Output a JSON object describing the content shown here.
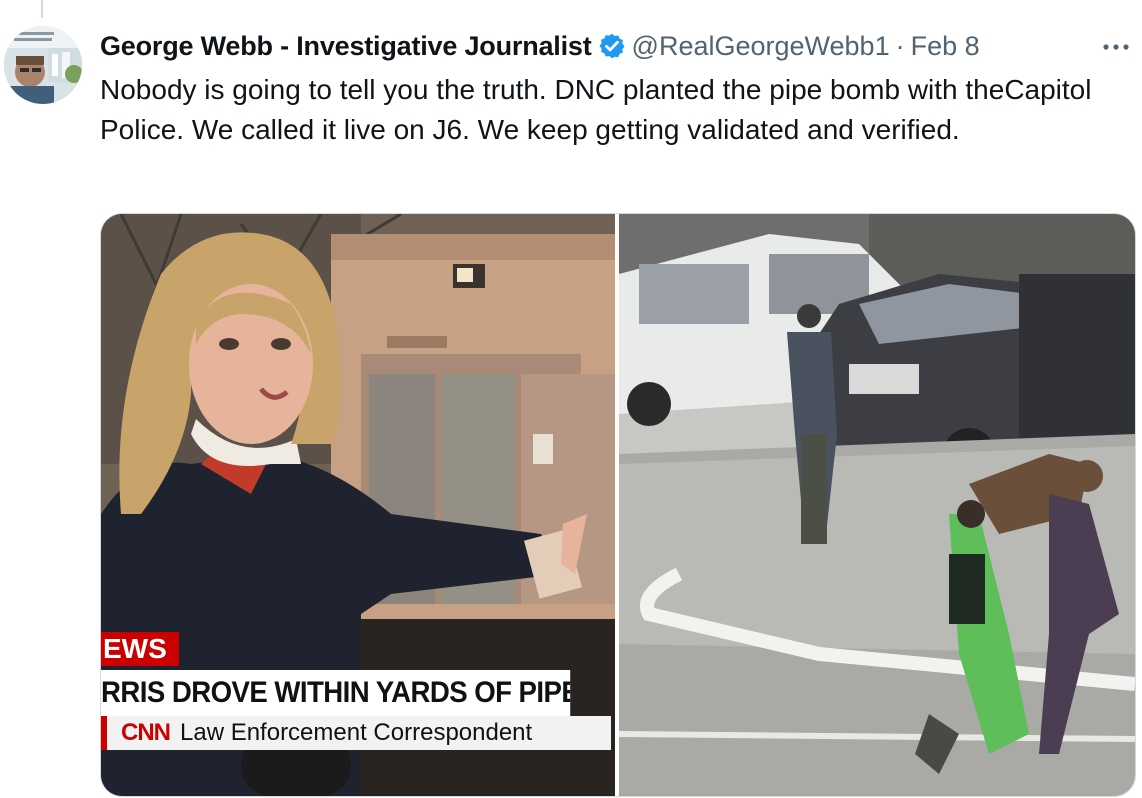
{
  "tweet": {
    "author": {
      "display_name": "George Webb - Investigative Journalist",
      "handle": "@RealGeorgeWebb1",
      "verified": true,
      "verified_color": "#1d9bf0"
    },
    "separator": "·",
    "date": "Feb 8",
    "more_icon": "ellipsis-icon",
    "text": "Nobody is going to tell you the truth. DNC planted the pipe bomb with theCapitol Police. We called it live on J6. We keep getting validated and verified."
  },
  "media": {
    "left_image": {
      "chyron_label": "EWS",
      "chyron_headline": "RRIS DROVE WITHIN YARDS OF PIPE BOMB AT",
      "network_logo": "CNN",
      "subtitle": "Law Enforcement Correspondent",
      "brand_color": "#cc0000"
    },
    "right_image": {}
  },
  "colors": {
    "text_primary": "#0f1419",
    "text_secondary": "#536471",
    "border": "#cfd9de"
  }
}
